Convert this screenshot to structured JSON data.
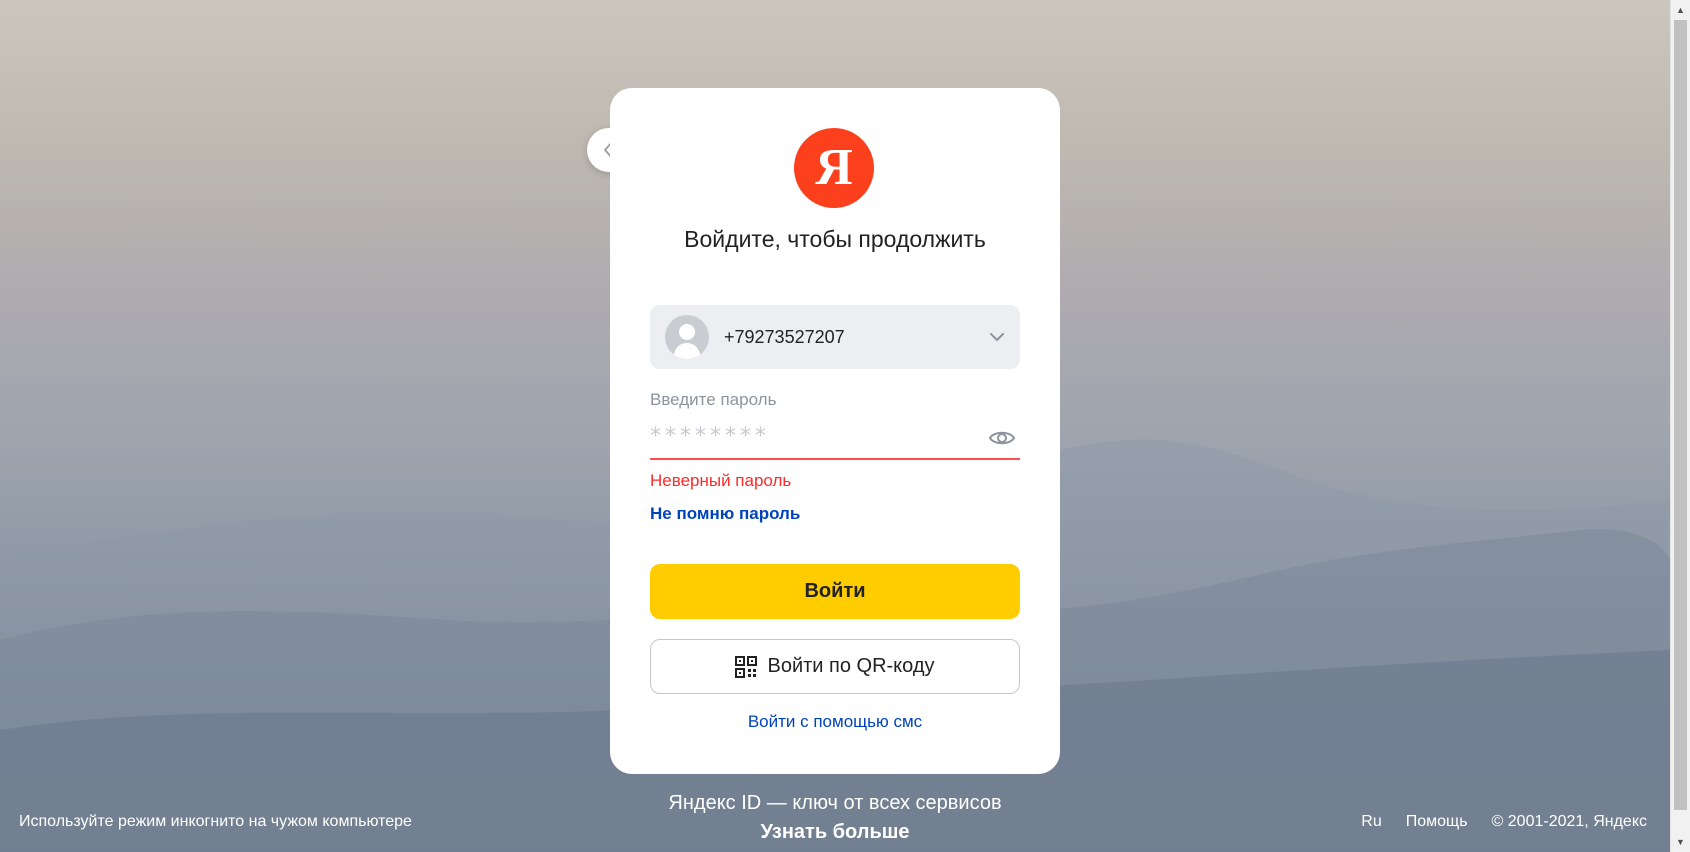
{
  "card": {
    "logo_letter": "Я",
    "title": "Войдите, чтобы продолжить"
  },
  "account": {
    "phone": "+79273527207"
  },
  "password": {
    "label": "Введите пароль",
    "placeholder": "********",
    "error": "Неверный пароль",
    "forgot_link": "Не помню пароль"
  },
  "actions": {
    "login_label": "Войти",
    "qr_label": "Войти по QR-коду",
    "sms_label": "Войти с помощью смс"
  },
  "footer": {
    "incognito_hint": "Используйте режим инкогнито на чужом компьютере",
    "tagline": "Яндекс ID — ключ от всех сервисов",
    "learn_more": "Узнать больше",
    "language": "Ru",
    "help": "Помощь",
    "copyright": "© 2001-2021, Яндекс"
  },
  "colors": {
    "brand_red": "#fc3f1d",
    "button_yellow": "#ffcc00",
    "link_blue": "#0044bb",
    "error_red": "#ff2929"
  },
  "icons": {
    "back": "chevron-left-icon",
    "avatar": "user-placeholder-icon",
    "dropdown": "chevron-down-icon",
    "show_password": "eye-icon",
    "qr": "qr-code-icon"
  }
}
